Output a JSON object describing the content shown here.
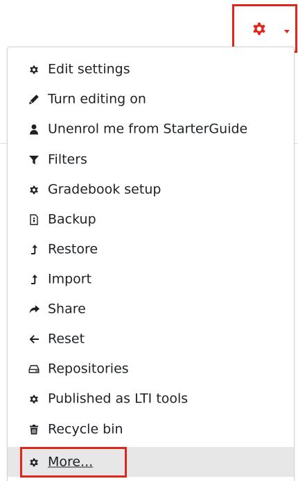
{
  "trigger": {
    "icon": "gear-icon",
    "caret_icon": "caret-down-icon",
    "color": "#e0261b"
  },
  "menu": {
    "items": [
      {
        "label": "Edit settings",
        "icon": "gear-icon"
      },
      {
        "label": "Turn editing on",
        "icon": "pencil-icon"
      },
      {
        "label": "Unenrol me from StarterGuide",
        "icon": "user-icon"
      },
      {
        "label": "Filters",
        "icon": "filter-icon"
      },
      {
        "label": "Gradebook setup",
        "icon": "gear-icon"
      },
      {
        "label": "Backup",
        "icon": "backup-file-icon"
      },
      {
        "label": "Restore",
        "icon": "level-up-icon"
      },
      {
        "label": "Import",
        "icon": "level-up-icon"
      },
      {
        "label": "Share",
        "icon": "share-arrow-icon"
      },
      {
        "label": "Reset",
        "icon": "arrow-left-icon"
      },
      {
        "label": "Repositories",
        "icon": "hard-drive-icon"
      },
      {
        "label": "Published as LTI tools",
        "icon": "gear-icon"
      },
      {
        "label": "Recycle bin",
        "icon": "trash-icon"
      },
      {
        "label": "More...",
        "icon": "gear-icon",
        "highlighted": true
      }
    ]
  },
  "colors": {
    "annotation_red": "#e0261b",
    "highlight_bg": "#e7e7e7",
    "text": "#1d2125"
  }
}
